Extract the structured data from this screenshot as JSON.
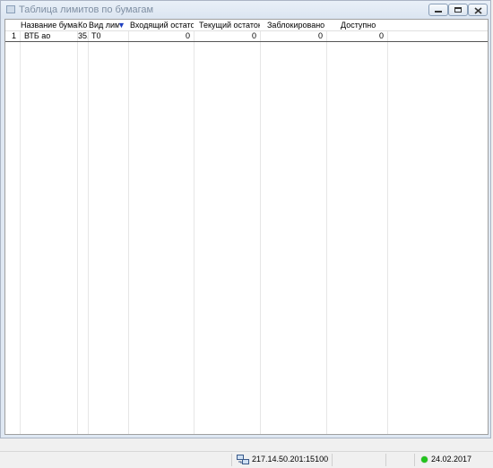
{
  "window": {
    "title": "Таблица лимитов по бумагам"
  },
  "table": {
    "columns": [
      {
        "label": "Название бумаги"
      },
      {
        "label": "Ко"
      },
      {
        "label": "Вид лим"
      },
      {
        "label": "Входящий остаток"
      },
      {
        "label": "Текущий остаток"
      },
      {
        "label": "Заблокировано"
      },
      {
        "label": "Доступно"
      }
    ],
    "sorted_column": "Вид лим",
    "sort_direction": "descending",
    "rows": [
      {
        "index": "1",
        "name": "ВТБ ао",
        "code": "35.",
        "limit_type": "T0",
        "incoming": "0",
        "current": "0",
        "blocked": "0",
        "available": "0"
      }
    ]
  },
  "statusbar": {
    "server": "217.14.50.201:15100",
    "date": "24.02.2017",
    "connection_color": "#22c41d"
  }
}
